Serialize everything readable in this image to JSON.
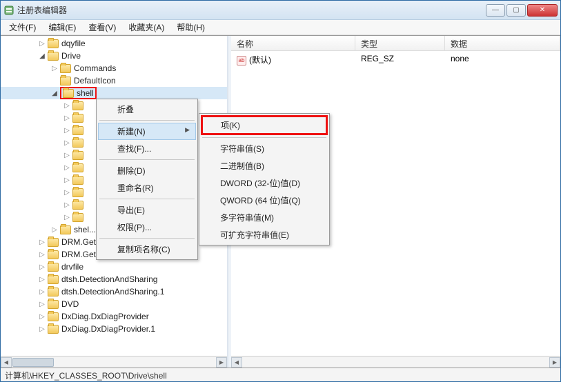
{
  "window": {
    "title": "注册表编辑器"
  },
  "menus": {
    "file": "文件(F)",
    "edit": "编辑(E)",
    "view": "查看(V)",
    "favorites": "收藏夹(A)",
    "help": "帮助(H)"
  },
  "tree": {
    "items": [
      {
        "indent": 3,
        "exp": "closed",
        "label": "dqyfile"
      },
      {
        "indent": 3,
        "exp": "open",
        "label": "Drive"
      },
      {
        "indent": 4,
        "exp": "closed",
        "label": "Commands"
      },
      {
        "indent": 4,
        "exp": "none",
        "label": "DefaultIcon"
      },
      {
        "indent": 4,
        "exp": "open",
        "label": "shell",
        "highlight": true,
        "selected": true
      },
      {
        "indent": 5,
        "exp": "closed",
        "label": ""
      },
      {
        "indent": 5,
        "exp": "closed",
        "label": ""
      },
      {
        "indent": 5,
        "exp": "closed",
        "label": ""
      },
      {
        "indent": 5,
        "exp": "closed",
        "label": ""
      },
      {
        "indent": 5,
        "exp": "closed",
        "label": ""
      },
      {
        "indent": 5,
        "exp": "closed",
        "label": ""
      },
      {
        "indent": 5,
        "exp": "closed",
        "label": ""
      },
      {
        "indent": 5,
        "exp": "closed",
        "label": ""
      },
      {
        "indent": 5,
        "exp": "closed",
        "label": ""
      },
      {
        "indent": 5,
        "exp": "closed",
        "label": ""
      },
      {
        "indent": 4,
        "exp": "closed",
        "label": "shel..."
      },
      {
        "indent": 3,
        "exp": "closed",
        "label": "DRM.GetLicense"
      },
      {
        "indent": 3,
        "exp": "closed",
        "label": "DRM.GetLicense.1"
      },
      {
        "indent": 3,
        "exp": "closed",
        "label": "drvfile"
      },
      {
        "indent": 3,
        "exp": "closed",
        "label": "dtsh.DetectionAndSharing"
      },
      {
        "indent": 3,
        "exp": "closed",
        "label": "dtsh.DetectionAndSharing.1"
      },
      {
        "indent": 3,
        "exp": "closed",
        "label": "DVD"
      },
      {
        "indent": 3,
        "exp": "closed",
        "label": "DxDiag.DxDiagProvider"
      },
      {
        "indent": 3,
        "exp": "closed",
        "label": "DxDiag.DxDiagProvider.1"
      }
    ]
  },
  "list": {
    "cols": {
      "name": "名称",
      "type": "类型",
      "data": "数据"
    },
    "rows": [
      {
        "name": "(默认)",
        "type": "REG_SZ",
        "data": "none"
      }
    ]
  },
  "ctx1": {
    "collapse": "折叠",
    "new": "新建(N)",
    "find": "查找(F)...",
    "delete": "删除(D)",
    "rename": "重命名(R)",
    "export": "导出(E)",
    "perms": "权限(P)...",
    "copykey": "复制项名称(C)"
  },
  "ctx2": {
    "key": "项(K)",
    "string": "字符串值(S)",
    "binary": "二进制值(B)",
    "dword": "DWORD (32-位)值(D)",
    "qword": "QWORD (64 位)值(Q)",
    "multistr": "多字符串值(M)",
    "expstr": "可扩充字符串值(E)"
  },
  "status": {
    "path": "计算机\\HKEY_CLASSES_ROOT\\Drive\\shell"
  }
}
